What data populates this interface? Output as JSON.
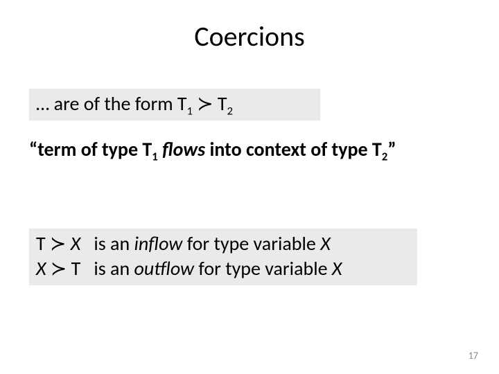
{
  "title": "Coercions",
  "box1": {
    "prefix": "… are of the form T",
    "sub1": "1",
    "op": " ≻ ",
    "t2": "T",
    "sub2": "2"
  },
  "defn": {
    "open_quote": "“",
    "part1": "term of type T",
    "sub1": "1",
    "flows": " flows",
    "part2": " into context of type T",
    "sub2": "2",
    "close_quote": "”"
  },
  "box2": {
    "line1": {
      "lhs_a": "T ",
      "op": "≻",
      "lhs_b": " X",
      "gap": "   is an ",
      "kw": "inflow",
      "tail": " for type variable ",
      "var": "X"
    },
    "line2": {
      "lhs_a": "X ",
      "op": "≻",
      "lhs_b": " T",
      "gap": "   is an ",
      "kw": "outflow",
      "tail": " for type variable ",
      "var": "X"
    }
  },
  "pagenum": "17"
}
